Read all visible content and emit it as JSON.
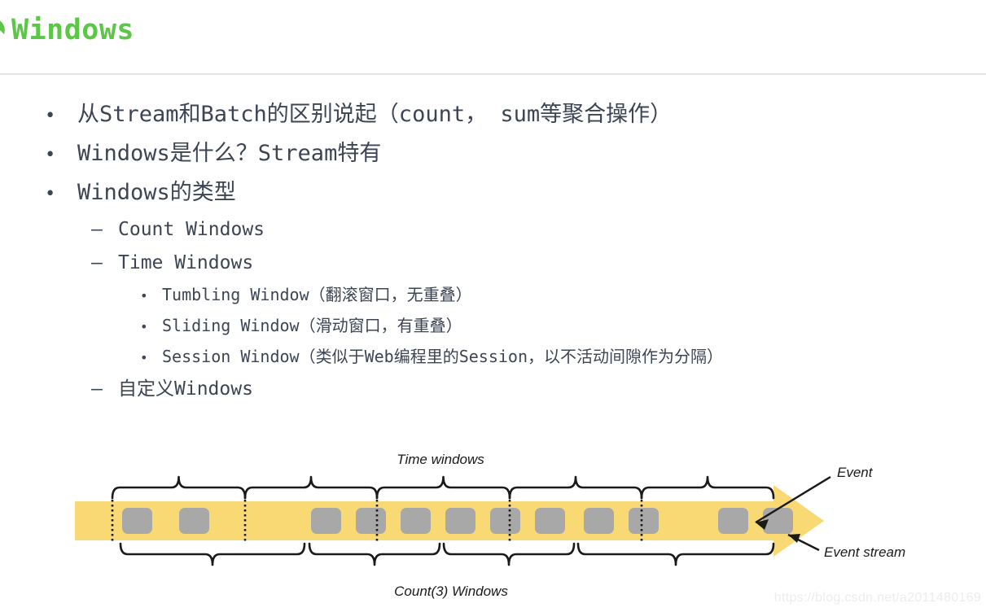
{
  "header": {
    "title": "Windows",
    "title_color": "#5cc746",
    "mark_icon": "leaf-check-icon"
  },
  "content": {
    "bullets": [
      {
        "level": 1,
        "marker": "•",
        "text": "从Stream和Batch的区别说起（count， sum等聚合操作）"
      },
      {
        "level": 1,
        "marker": "•",
        "text": "Windows是什么？Stream特有"
      },
      {
        "level": 1,
        "marker": "•",
        "text": "Windows的类型"
      },
      {
        "level": 2,
        "marker": "–",
        "text": "Count Windows"
      },
      {
        "level": 2,
        "marker": "–",
        "text": "Time Windows"
      },
      {
        "level": 3,
        "marker": "•",
        "text": "Tumbling Window（翻滚窗口，无重叠）"
      },
      {
        "level": 3,
        "marker": "•",
        "text": "Sliding Window（滑动窗口，有重叠）"
      },
      {
        "level": 3,
        "marker": "•",
        "text": "Session Window（类似于Web编程里的Session，以不活动间隙作为分隔）"
      },
      {
        "level": 2,
        "marker": "–",
        "text": "自定义Windows"
      }
    ]
  },
  "diagram": {
    "top_label": "Time windows",
    "bottom_label": "Count(3) Windows",
    "event_label": "Event",
    "stream_label": "Event stream",
    "stream_color": "#f8d974",
    "event_color": "#a8a8a8",
    "line_color": "#1a1a1a",
    "events_x": [
      58,
      128,
      290,
      345,
      400,
      455,
      510,
      565,
      625,
      680,
      790,
      845
    ],
    "dividers_x": [
      46,
      209,
      371,
      534,
      696
    ],
    "time_windows": [
      {
        "start": 46,
        "end": 209
      },
      {
        "start": 209,
        "end": 371
      },
      {
        "start": 371,
        "end": 534
      },
      {
        "start": 534,
        "end": 696
      },
      {
        "start": 696,
        "end": 858
      }
    ],
    "count_windows": [
      {
        "start": 56,
        "end": 282
      },
      {
        "start": 288,
        "end": 448
      },
      {
        "start": 453,
        "end": 613
      },
      {
        "start": 618,
        "end": 858
      }
    ]
  },
  "watermark": {
    "text": "https://blog.csdn.net/a2011480169"
  }
}
